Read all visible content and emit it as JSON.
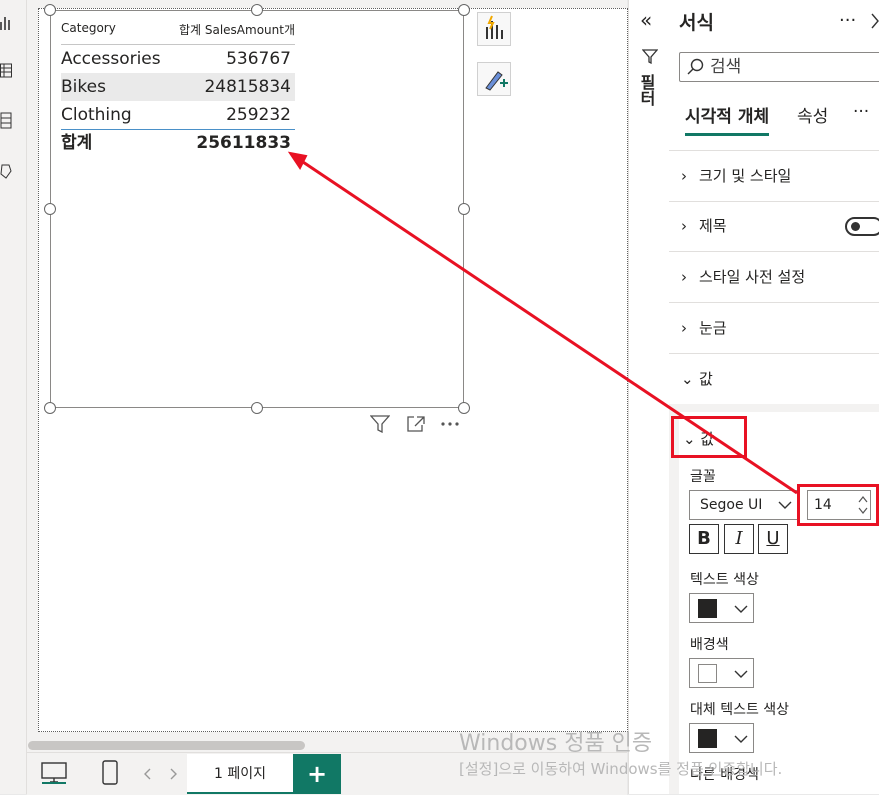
{
  "table": {
    "headers": [
      "Category",
      "합계 SalesAmount개"
    ],
    "rows": [
      {
        "category": "Accessories",
        "value": "536767"
      },
      {
        "category": "Bikes",
        "value": "24815834"
      },
      {
        "category": "Clothing",
        "value": "259232"
      }
    ],
    "total": {
      "label": "합계",
      "value": "25611833"
    }
  },
  "bottom": {
    "page_tab": "1 페이지",
    "add_label": "+"
  },
  "filters": {
    "label": "필터",
    "collapse_glyph": "«"
  },
  "format_pane": {
    "title": "서식",
    "more": "···",
    "search_placeholder": "검색",
    "tabs": [
      "시각적 개체",
      "속성"
    ],
    "tab_more": "···",
    "sections": [
      {
        "label": "크기 및 스타일",
        "expanded": false
      },
      {
        "label": "제목",
        "expanded": false
      },
      {
        "label": "스타일 사전 설정",
        "expanded": false
      },
      {
        "label": "눈금",
        "expanded": false
      },
      {
        "label": "값",
        "expanded": true
      }
    ],
    "values_card": {
      "header": "값",
      "font_label": "글꼴",
      "font_family": "Segoe UI",
      "font_size": "14",
      "bold": "B",
      "italic": "I",
      "underline": "U",
      "text_color_label": "텍스트 색상",
      "text_color": "#252423",
      "background_label": "배경색",
      "background_color": "#ffffff",
      "alt_text_label": "대체 텍스트 색상",
      "alt_text_color": "#252423",
      "other_bg_label": "다른 배경색"
    }
  },
  "watermark": {
    "line1": "Windows 정품 인증",
    "line2": "[설정]으로 이동하여 Windows를 정품 인증합니다."
  },
  "colors": {
    "accent": "#117865",
    "highlight": "#e81123"
  }
}
